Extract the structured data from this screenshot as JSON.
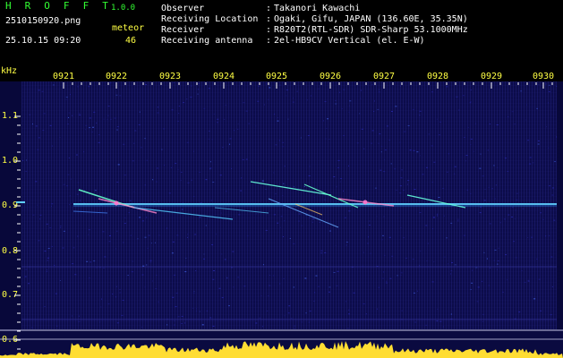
{
  "app": {
    "title": "H R O F F T",
    "version": "1.0.0"
  },
  "capture": {
    "filename": "2510150920.png",
    "datetime": "25.10.15 09:20",
    "mode_label": "meteor",
    "count": "46"
  },
  "header": {
    "rows": [
      {
        "label": "Observer",
        "value": "Takanori Kawachi"
      },
      {
        "label": "Receiving Location",
        "value": "Ogaki, Gifu, JAPAN (136.60E, 35.35N)"
      },
      {
        "label": "Receiver",
        "value": "R820T2(RTL-SDR) SDR-Sharp 53.1000MHz"
      },
      {
        "label": "Receiving antenna",
        "value": "2el-HB9CV Vertical (el. E-W)"
      }
    ]
  },
  "spectrogram": {
    "y_unit": "kHz",
    "time_labels": [
      "0921",
      "0922",
      "0923",
      "0924",
      "0925",
      "0926",
      "0927",
      "0928",
      "0929",
      "0930"
    ],
    "freq_labels": [
      "1.1",
      "1.0",
      "0.9",
      "0.8",
      "0.7",
      "0.6"
    ],
    "freq_range_khz": [
      0.6,
      1.15
    ],
    "carrier_khz": 0.905
  },
  "colors": {
    "title": "#33ff33",
    "labels": "#ffff44",
    "background": "#0c0c4a",
    "carrier": "#5fd0ff",
    "level": "#ffdd33"
  }
}
